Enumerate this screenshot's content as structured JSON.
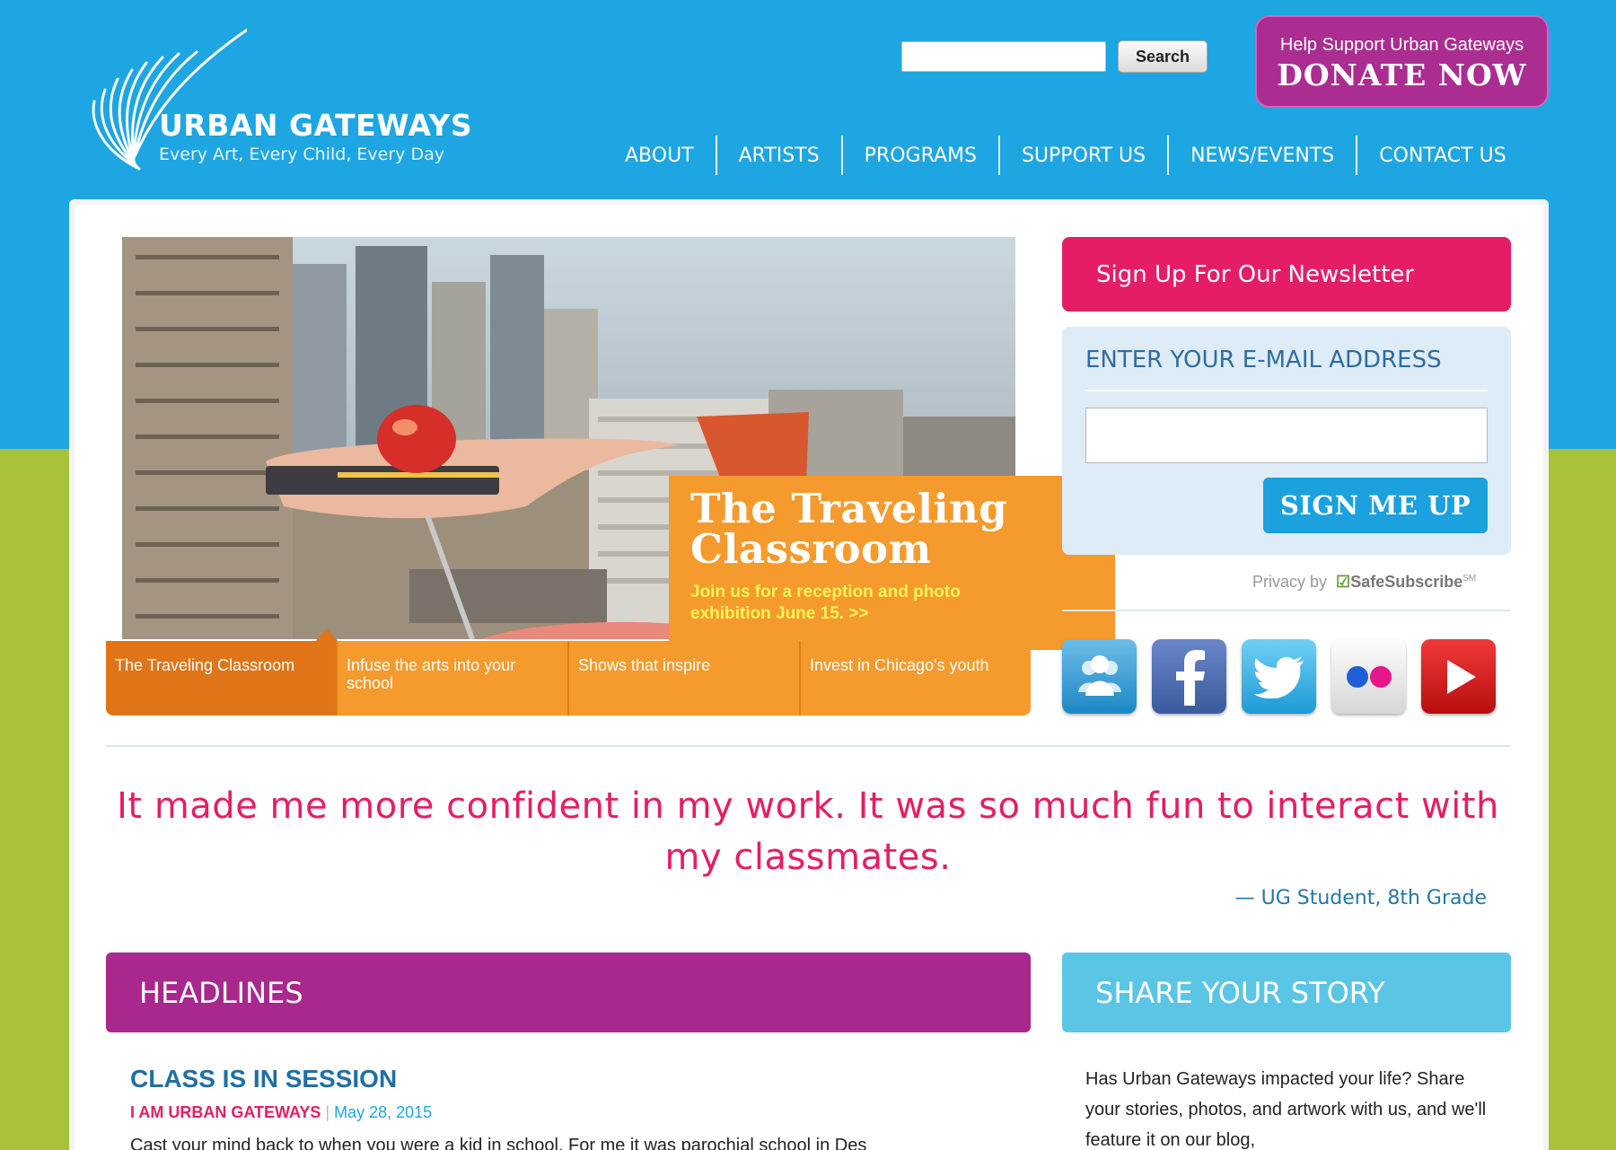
{
  "colors": {
    "sky": "#1ea6e2",
    "lime": "#a7c13b",
    "magenta": "#e51d67",
    "purple": "#a8288d",
    "orange": "#f59a2c",
    "light_blue": "#5bc5e6"
  },
  "header": {
    "logo_name": "URBAN GATEWAYS",
    "logo_tagline": "Every Art, Every Child, Every Day",
    "search_value": "",
    "search_button": "Search",
    "donate_small": "Help Support Urban Gateways",
    "donate_big": "DONATE NOW"
  },
  "nav": [
    "ABOUT",
    "ARTISTS",
    "PROGRAMS",
    "SUPPORT US",
    "NEWS/EVENTS",
    "CONTACT US"
  ],
  "slider": {
    "title_line1": "The Traveling",
    "title_line2": "Classroom",
    "subtitle": "Join us for a reception and photo exhibition June 15. >>",
    "tabs": [
      "The Traveling Classroom",
      "Infuse the arts into your school",
      "Shows that inspire",
      "Invest in Chicago's youth"
    ],
    "active_tab": 0
  },
  "newsletter": {
    "header": "Sign Up For Our Newsletter",
    "label": "ENTER YOUR E-MAIL ADDRESS",
    "email_value": "",
    "button": "SIGN ME UP",
    "privacy_prefix": "Privacy by",
    "privacy_brand": "SafeSubscribe",
    "privacy_mark": "SM"
  },
  "social": [
    "community-icon",
    "facebook-icon",
    "twitter-icon",
    "flickr-icon",
    "youtube-icon"
  ],
  "quote": {
    "text": "It made me more confident in my work. It was so much fun to interact with my classmates.",
    "source": "— UG Student, 8th Grade"
  },
  "headlines": {
    "title": "HEADLINES",
    "article": {
      "title": "CLASS IS IN SESSION",
      "category": "I AM URBAN GATEWAYS",
      "separator": "|",
      "date": "May 28, 2015",
      "excerpt": "Cast your mind back to when you were a kid in school. For me it was parochial school in Des"
    }
  },
  "share": {
    "title": "SHARE YOUR STORY",
    "text": "Has Urban Gateways impacted your life? Share your stories, photos, and artwork with us, and we'll feature it on our blog,"
  }
}
